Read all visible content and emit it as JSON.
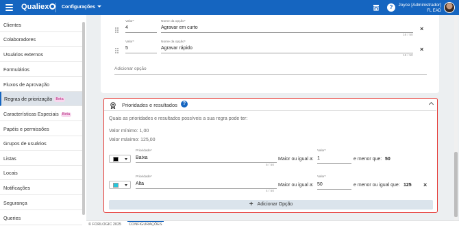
{
  "header": {
    "logo_text": "Qualiex",
    "module_label": "Configurações",
    "help_glyph": "?",
    "user_name": "Joyce [Administrador]",
    "user_org": "FL EAD",
    "icons": [
      "menu-icon",
      "logo-icon",
      "chevron-down-icon",
      "shop-icon",
      "help-icon",
      "avatar"
    ]
  },
  "sidebar": {
    "items": [
      {
        "label": "Clientes"
      },
      {
        "label": "Colaboradores"
      },
      {
        "label": "Usuários externos"
      },
      {
        "label": "Formulários"
      },
      {
        "label": "Fluxos de Aprovação"
      },
      {
        "label": "Regras de priorização",
        "badge": "Beta",
        "active": true
      },
      {
        "label": "Características Especiais",
        "badge": "Beta"
      },
      {
        "label": "Papéis e permissões"
      },
      {
        "label": "Grupos de usuários"
      },
      {
        "label": "Listas"
      },
      {
        "label": "Locais"
      },
      {
        "label": "Notificações"
      },
      {
        "label": "Segurança"
      },
      {
        "label": "Queries"
      }
    ]
  },
  "options_card": {
    "value_label": "Valor*",
    "name_label": "Nome da opção*",
    "options": [
      {
        "value": "4",
        "name": "Agravar em curto",
        "count": "16 / 50"
      },
      {
        "value": "5",
        "name": "Agravar rápido",
        "count": "16 / 50"
      }
    ],
    "remove_glyph": "×",
    "add_option_placeholder": "Adicionar opção"
  },
  "priorities_card": {
    "title": "Prioridades e resultados",
    "help_glyph": "?",
    "description": "Quais as prioridades e resultados possíveis a sua regra pode ter:",
    "min_value": "Valor mínimo: 1,00",
    "max_value": "Valor máximo: 125,00",
    "priority_label": "Prioridade*",
    "value_label": "Valor*",
    "rows": [
      {
        "color": "#000000",
        "priority": "Baixa",
        "count": "5 / 50",
        "compare_label": "Maior ou igual a:",
        "value": "1",
        "upper_label": "e menor que:",
        "upper": "50",
        "removable": false
      },
      {
        "color": "#26c6da",
        "priority": "Alta",
        "count": "4 / 50",
        "compare_label": "Maior ou igual a:",
        "value": "50",
        "upper_label": "e menor ou igual que:",
        "upper": "125",
        "removable": true
      }
    ],
    "remove_glyph": "×",
    "add_button": "Adicionar Opção",
    "add_glyph": "+"
  },
  "footer": {
    "copyright": "© FORLOGIC 2025",
    "section": "CONFIGURAÇÕES"
  },
  "colors": {
    "header_bg": "#1565c0",
    "highlight_border": "#e53935",
    "beta_bg": "#f8d7ee",
    "beta_text": "#b4237c",
    "add_button_bg": "#dbe4ec"
  }
}
